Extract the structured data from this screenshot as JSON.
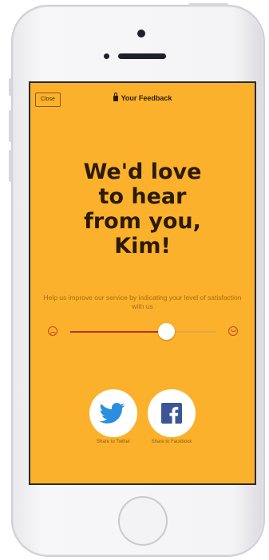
{
  "header": {
    "close_label": "Close",
    "title": "Your Feedback"
  },
  "main": {
    "headline": [
      "We'd love",
      "to hear",
      "from you,",
      "Kim!"
    ],
    "help_text": "Help us improve our service by indicating your level of satisfaction with us",
    "satisfaction_fraction": 0.66
  },
  "share": {
    "twitter_label": "Share to Twitter",
    "facebook_label": "Share to Facebook"
  },
  "colors": {
    "screen_background": "#fbb12c",
    "slider_fill": "#b3351a",
    "twitter_blue": "#2a8fe0",
    "facebook_blue": "#3c5596"
  },
  "icons": {
    "sad_face": "sad-face-icon",
    "happy_face": "happy-face-icon",
    "twitter": "twitter-icon",
    "facebook": "facebook-icon",
    "lock": "lock-icon"
  }
}
